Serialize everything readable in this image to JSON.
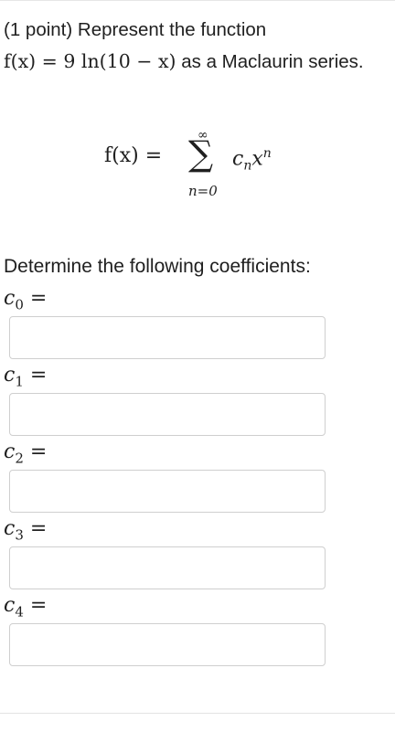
{
  "problem": {
    "prefix": "(1 point) Represent the function",
    "function_text": "f(x) = 9 ln(10 − x)",
    "suffix": "as a Maclaurin series."
  },
  "series": {
    "lhs": "f(x) =",
    "sigma": "∑",
    "upper": "∞",
    "lower": "n=0",
    "coef": "c",
    "coef_sub": "n",
    "var": "x",
    "var_sup": "n"
  },
  "instruction": "Determine the following coefficients:",
  "coefficients": [
    {
      "name": "c",
      "index": "0",
      "eq": "=",
      "value": ""
    },
    {
      "name": "c",
      "index": "1",
      "eq": "=",
      "value": ""
    },
    {
      "name": "c",
      "index": "2",
      "eq": "=",
      "value": ""
    },
    {
      "name": "c",
      "index": "3",
      "eq": "=",
      "value": ""
    },
    {
      "name": "c",
      "index": "4",
      "eq": "=",
      "value": ""
    }
  ]
}
